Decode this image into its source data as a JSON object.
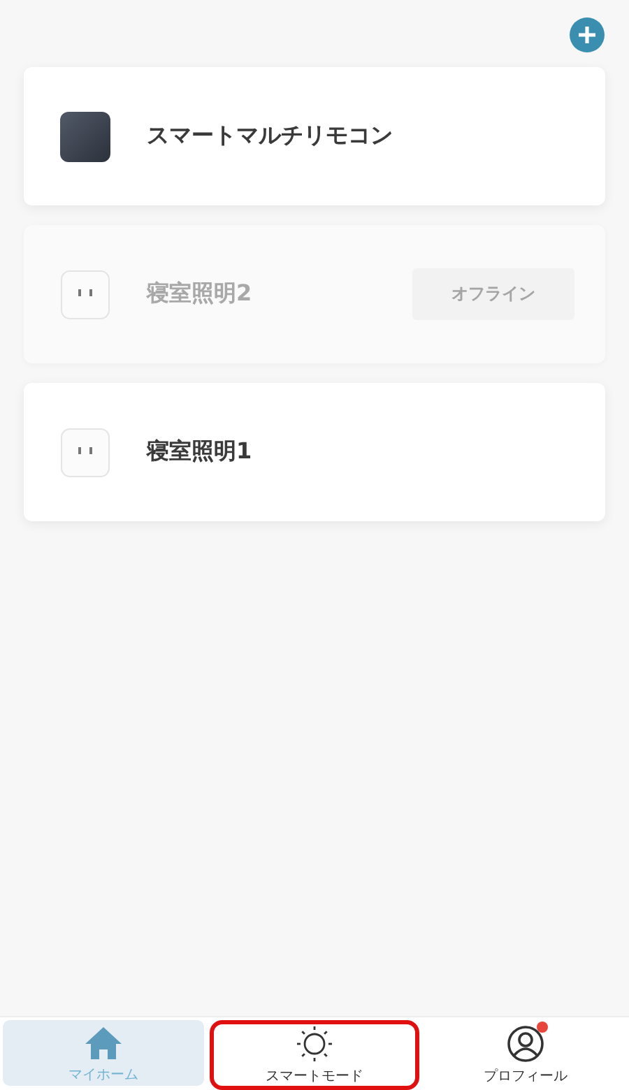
{
  "devices": [
    {
      "name": "スマートマルチリモコン",
      "kind": "remote",
      "offline": false
    },
    {
      "name": "寝室照明2",
      "kind": "plug",
      "offline": true,
      "status": "オフライン"
    },
    {
      "name": "寝室照明1",
      "kind": "plug",
      "offline": false
    }
  ],
  "tabs": [
    {
      "label": "マイホーム",
      "kind": "home",
      "selected": true,
      "highlighted": false,
      "badge": false
    },
    {
      "label": "スマートモード",
      "kind": "sun",
      "selected": false,
      "highlighted": true,
      "badge": false
    },
    {
      "label": "プロフィール",
      "kind": "person",
      "selected": false,
      "highlighted": false,
      "badge": true
    }
  ]
}
